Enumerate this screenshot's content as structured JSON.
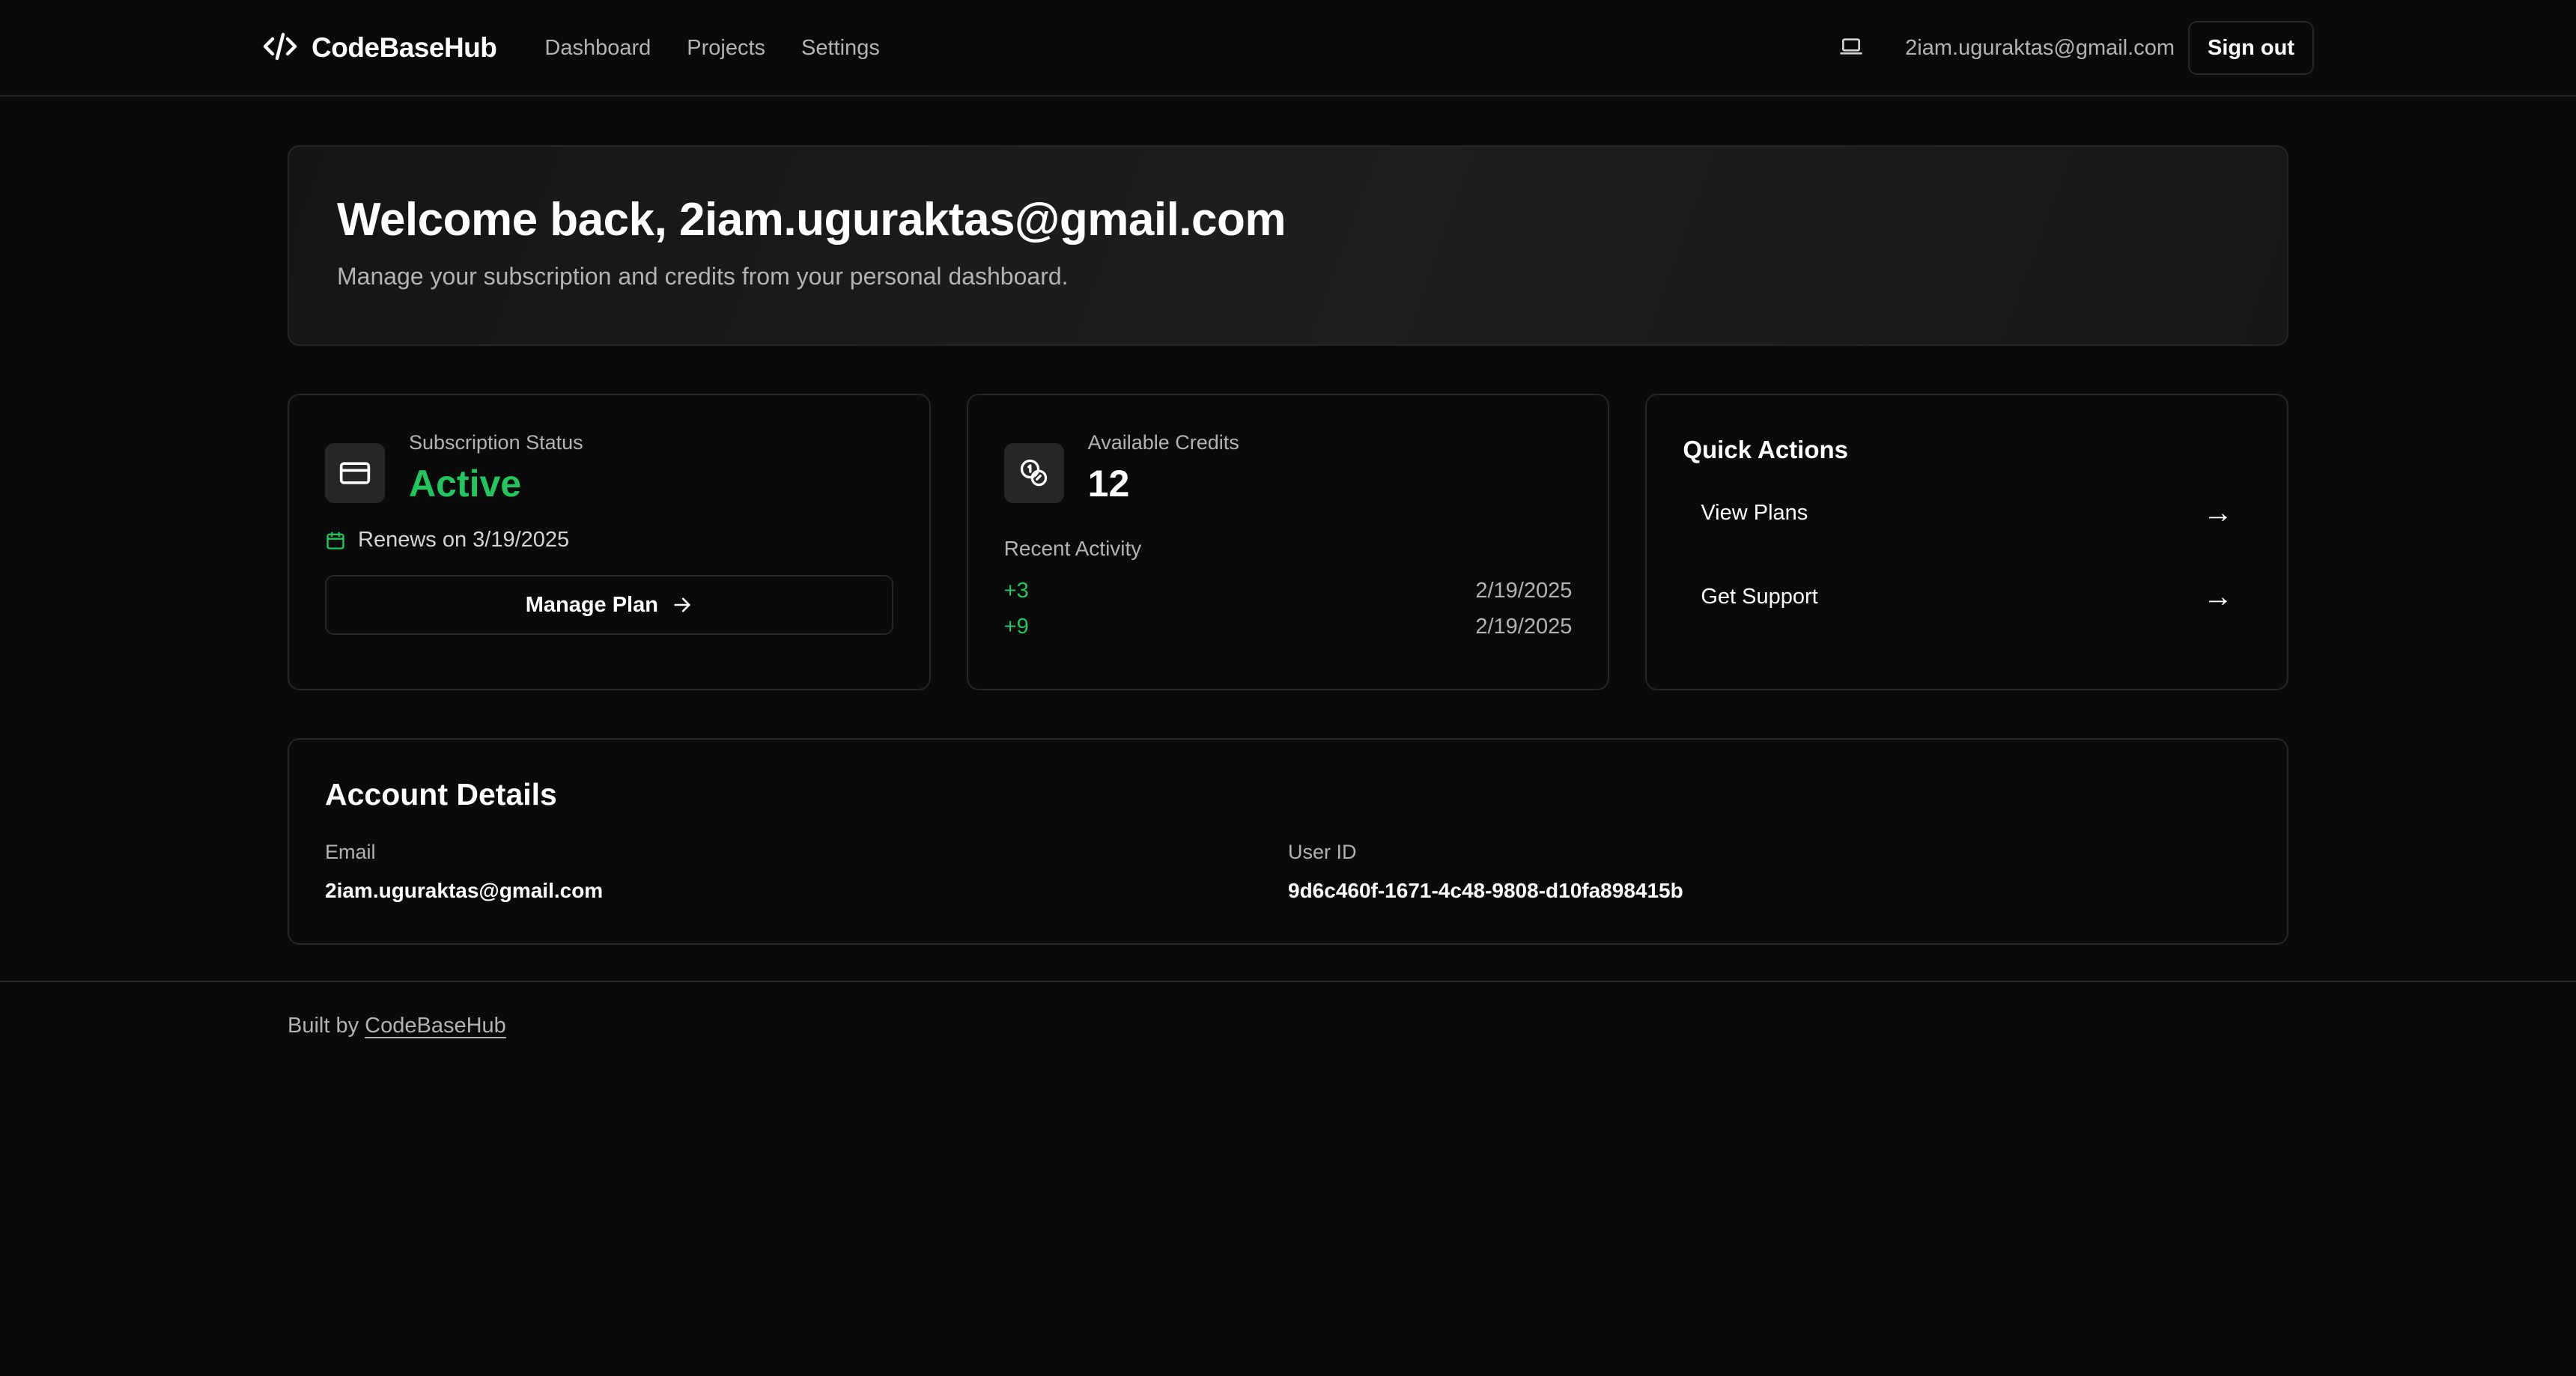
{
  "header": {
    "brand": "CodeBaseHub",
    "nav": [
      "Dashboard",
      "Projects",
      "Settings"
    ],
    "email": "2iam.uguraktas@gmail.com",
    "signout_label": "Sign out"
  },
  "welcome": {
    "title": "Welcome back, 2iam.uguraktas@gmail.com",
    "subtitle": "Manage your subscription and credits from your personal dashboard."
  },
  "subscription": {
    "label": "Subscription Status",
    "status": "Active",
    "renews": "Renews on 3/19/2025",
    "manage_label": "Manage Plan"
  },
  "credits": {
    "label": "Available Credits",
    "value": "12",
    "recent_label": "Recent Activity",
    "activity": [
      {
        "amount": "+3",
        "date": "2/19/2025"
      },
      {
        "amount": "+9",
        "date": "2/19/2025"
      }
    ]
  },
  "quick_actions": {
    "title": "Quick Actions",
    "items": [
      {
        "label": "View Plans",
        "arrow": "→"
      },
      {
        "label": "Get Support",
        "arrow": "→"
      }
    ]
  },
  "account": {
    "title": "Account Details",
    "email_label": "Email",
    "email_value": "2iam.uguraktas@gmail.com",
    "userid_label": "User ID",
    "userid_value": "9d6c460f-1671-4c48-9808-d10fa898415b"
  },
  "footer": {
    "prefix": "Built by",
    "link": "CodeBaseHub"
  },
  "colors": {
    "background": "#0a0a0a",
    "border": "#262626",
    "accent_green": "#22c55e",
    "muted_text": "#b3b3b3"
  },
  "icons": [
    "code-icon",
    "laptop-icon",
    "credit-card-icon",
    "calendar-icon",
    "arrow-right-icon",
    "coins-icon"
  ]
}
